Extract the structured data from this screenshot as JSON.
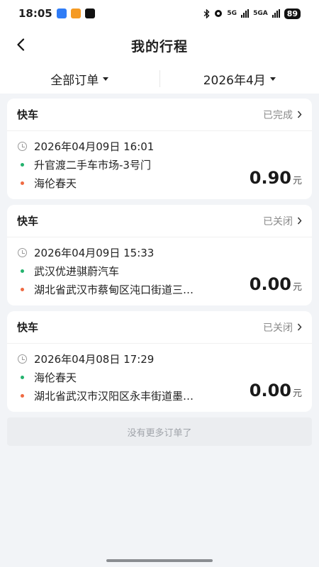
{
  "status_bar": {
    "time": "18:05",
    "net_5g": "5G",
    "net_5ga": "5GA",
    "battery": "89"
  },
  "nav": {
    "title": "我的行程"
  },
  "filters": {
    "order_type": "全部订单",
    "month": "2026年4月"
  },
  "orders": [
    {
      "type": "快车",
      "status": "已完成",
      "datetime": "2026年04月09日 16:01",
      "from": "升官渡二手车市场-3号门",
      "to": "海伦春天",
      "amount": "0.90",
      "unit": "元"
    },
    {
      "type": "快车",
      "status": "已关闭",
      "datetime": "2026年04月09日 15:33",
      "from": "武汉优进骐蔚汽车",
      "to": "湖北省武汉市蔡甸区沌口街道三…",
      "amount": "0.00",
      "unit": "元"
    },
    {
      "type": "快车",
      "status": "已关闭",
      "datetime": "2026年04月08日 17:29",
      "from": "海伦春天",
      "to": "湖北省武汉市汉阳区永丰街道墨…",
      "amount": "0.00",
      "unit": "元"
    }
  ],
  "footer": {
    "no_more": "没有更多订单了"
  },
  "colors": {
    "origin_dot": "#23b26d",
    "dest_dot": "#ef6a42",
    "background": "#f2f4f7"
  }
}
